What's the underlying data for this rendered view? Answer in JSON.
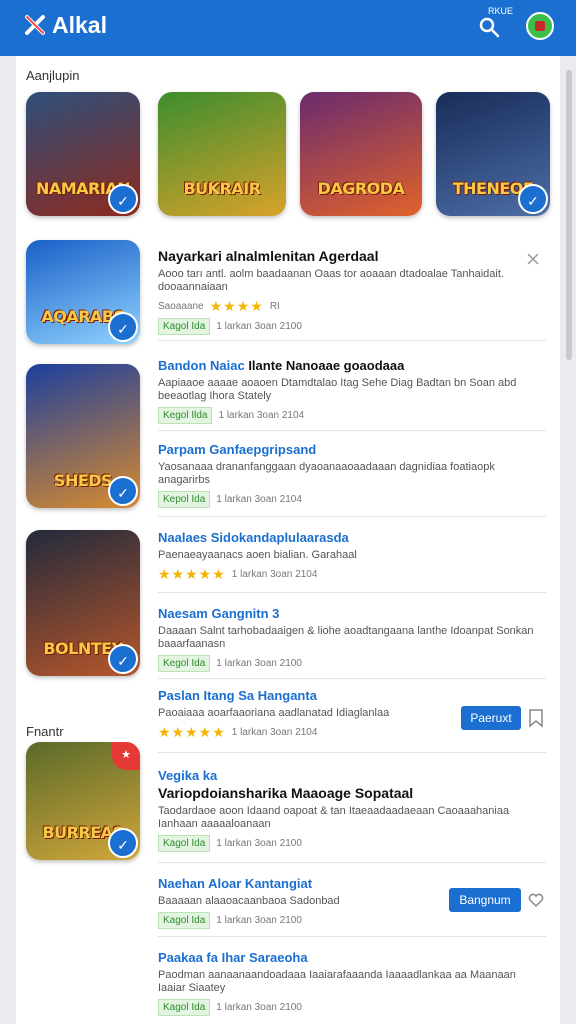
{
  "header": {
    "brand": "Alkal",
    "tiny_label": "RKUE"
  },
  "sections": {
    "top_title": "Aanjlupin",
    "side_title": "Fnantr"
  },
  "featured": [
    {
      "title": "NAMARIAN",
      "colors": [
        "#2d4f7a",
        "#8d2a1e"
      ]
    },
    {
      "title": "BUKRAIR",
      "colors": [
        "#3c8d2f",
        "#d8a22a"
      ]
    },
    {
      "title": "DAGRODA",
      "colors": [
        "#6a2b6e",
        "#e0622b"
      ]
    },
    {
      "title": "THENEOE",
      "colors": [
        "#182c58",
        "#4d6ea8"
      ]
    }
  ],
  "side_tiles": [
    {
      "title": "AQARABS",
      "colors": [
        "#1a5fc7",
        "#8fd3ff"
      ]
    },
    {
      "title": "SHEDS",
      "colors": [
        "#1c3f9e",
        "#d98b2d"
      ]
    },
    {
      "title": "BOLNTEY",
      "colors": [
        "#222a3c",
        "#b7562a"
      ]
    },
    {
      "title": "BURREAS",
      "colors": [
        "#5a6a2a",
        "#d1a63a"
      ]
    }
  ],
  "items": [
    {
      "title": "Nayarkari alnalmlenitan Agerdaal",
      "desc": "Aooo tarı antl. aolm baadaanan Oaas tor aoaaan dtadoalae Tanhaidait. dooaannaiaan",
      "tag": "",
      "rating_text": "Saoaaane",
      "stars": "★★★★",
      "rating_suffix": "RI",
      "date": ""
    },
    {
      "title": "",
      "desc": "",
      "tag": "Kagol",
      "tag_extra": "Ida",
      "stars": "",
      "date": "1 larkan 3oan 2100"
    },
    {
      "title": "Bandon Naiac",
      "subtitle": "Ilante Nanoaae goaodaaa",
      "desc": "Aapiaaoe aaaae aoaoen Dtamdtalao Itag Sehe Diag Badtan bn Soan abd beeaotlag Ihora Stately",
      "tag": "Kegol",
      "tag_extra": "Ilda",
      "date": "1 larkan 3oan 2104"
    },
    {
      "title": "Parpam Ganfaepgripsand",
      "desc": "Yaosanaaa drananfanggaan dyaoanaaoaadaaan dagnidiaa foatiaopk anagarirbs",
      "tag": "Kepol",
      "tag_extra": "Ida",
      "date": "1 larkan 3oan 2104"
    },
    {
      "title": "Naalaes Sidokandaplulaarasda",
      "desc": "Paenaeayaanacs aoen bialian. Garahaal",
      "stars": "★★★★★",
      "date": "1 larkan 3oan 2104"
    },
    {
      "title": "Naesam Gangnitn 3",
      "desc": "Daaaan Salnt tarhobadaaigen & liohe aoadtangaana lanthe Idoanpat Sonkan baaarfaanasn",
      "tag": "Kegol",
      "tag_extra": "Ida",
      "date": "1 larkan 3oan 2100"
    },
    {
      "title": "Paslan Itang Sa Hanganta",
      "desc": "Paoaiaaa aoarfaaoriana aadlanatad Idiaglanlaa",
      "stars": "★★★★★",
      "date": "1 larkan 3oan 2104",
      "button": "Paeruxt"
    },
    {
      "title": "Vegika ka",
      "subtitle": "Variopdoiansharika Maaoage Sopataal",
      "desc": "Taodardaoe aoon Idaand oapoat & tan Itaeaadaadaeaan Caoaaahaniaa Ianhaan aaaaaloanaan",
      "tag": "Kagol",
      "tag_extra": "Ida",
      "date": "1 larkan 3oan 2100"
    },
    {
      "title": "Naehan Aloar Kantangiat",
      "desc": "Baaaaan alaaoacaanbaoa Sadonbad",
      "tag": "Kagol",
      "tag_extra": "Ida",
      "date": "1 larkan 3oan 2100",
      "button": "Bangnum"
    },
    {
      "title": "Paakaa fa Ihar Saraeoha",
      "desc": "Paodman aanaanaandoadaaa Iaaiarafaaanda Iaaaadlankaa aa Maanaan Iaaiar Siaatey",
      "tag": "Kagol",
      "tag_extra": "Ida",
      "date": "1 larkan 3oan 2100"
    }
  ]
}
